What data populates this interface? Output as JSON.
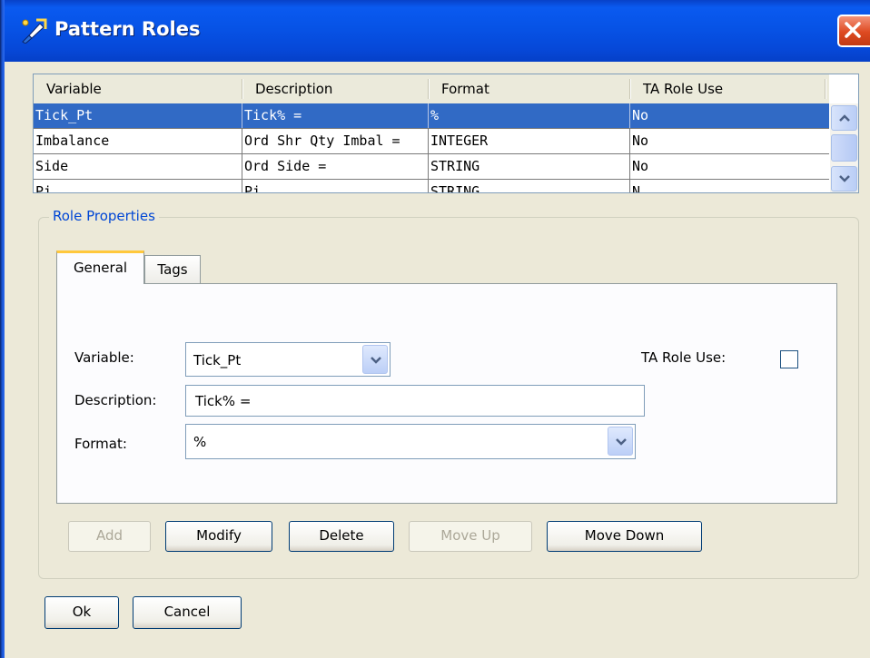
{
  "window": {
    "title": "Pattern Roles"
  },
  "table": {
    "columns": [
      "Variable",
      "Description",
      "Format",
      "TA Role Use"
    ],
    "rows": [
      {
        "variable": "Tick_Pt",
        "description": "Tick% =",
        "format": "%",
        "ta_role_use": "No"
      },
      {
        "variable": "Imbalance",
        "description": "Ord Shr Qty Imbal =",
        "format": "INTEGER",
        "ta_role_use": "No"
      },
      {
        "variable": "Side",
        "description": "Ord Side =",
        "format": "STRING",
        "ta_role_use": "No"
      },
      {
        "variable": "Pi",
        "description": "Pi",
        "format": "STRING",
        "ta_role_use": "N"
      }
    ],
    "selected_row": 0
  },
  "role_properties": {
    "title": "Role Properties",
    "tabs": [
      "General",
      "Tags"
    ],
    "active_tab": "General",
    "variable_label": "Variable:",
    "variable_value": "Tick_Pt",
    "description_label": "Description:",
    "description_value": "Tick% =",
    "format_label": "Format:",
    "format_value": "%",
    "ta_role_use_label": "TA Role Use:",
    "ta_role_use_checked": false
  },
  "actions": {
    "add": "Add",
    "modify": "Modify",
    "delete": "Delete",
    "move_up": "Move Up",
    "move_down": "Move Down"
  },
  "footer": {
    "ok": "Ok",
    "cancel": "Cancel"
  },
  "colors": {
    "title_bar": "#0a5af0",
    "selection": "#316ac5",
    "group_title": "#0046d5",
    "active_tab_accent": "#ffc83c"
  },
  "icons": {
    "title": "pattern-roles-icon",
    "close": "close-icon",
    "scroll_up": "chevron-up-icon",
    "scroll_down": "chevron-down-icon",
    "dropdown": "chevron-down-icon"
  }
}
